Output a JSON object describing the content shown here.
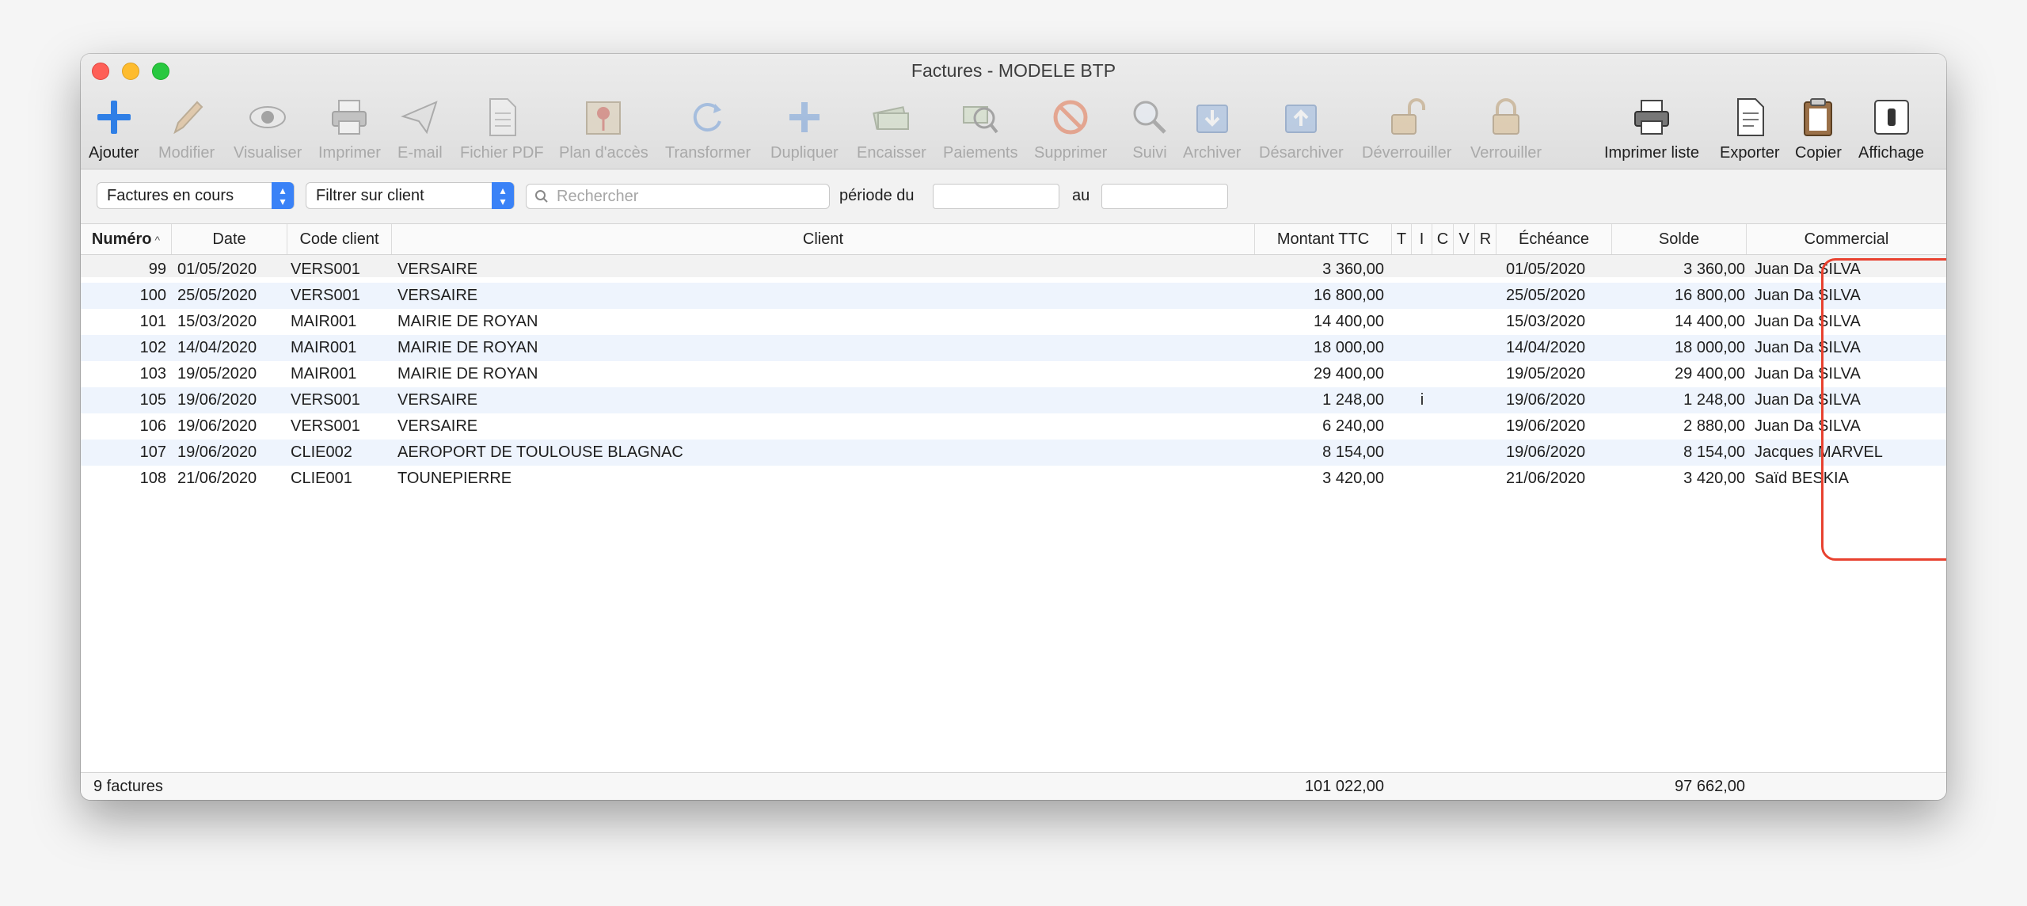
{
  "window": {
    "title": "Factures - MODELE BTP"
  },
  "toolbar": {
    "ajouter": "Ajouter",
    "modifier": "Modifier",
    "visualiser": "Visualiser",
    "imprimer": "Imprimer",
    "email": "E-mail",
    "pdf": "Fichier PDF",
    "plan": "Plan d'accès",
    "transformer": "Transformer",
    "dupliquer": "Dupliquer",
    "encaisser": "Encaisser",
    "paiements": "Paiements",
    "supprimer": "Supprimer",
    "suivi": "Suivi",
    "archiver": "Archiver",
    "desarchiver": "Désarchiver",
    "deverrouiller": "Déverrouiller",
    "verrouiller": "Verrouiller",
    "imprimer_liste": "Imprimer liste",
    "exporter": "Exporter",
    "copier": "Copier",
    "affichage": "Affichage"
  },
  "filters": {
    "status_select": "Factures en cours",
    "client_select": "Filtrer sur client",
    "search_placeholder": "Rechercher",
    "period_label": "période du",
    "to_label": "au"
  },
  "table": {
    "columns": [
      "Numéro",
      "Date",
      "Code client",
      "Client",
      "Montant TTC",
      "T",
      "I",
      "C",
      "V",
      "R",
      "Échéance",
      "Solde",
      "Commercial"
    ],
    "rows": [
      {
        "num": "99",
        "date": "01/05/2020",
        "code": "VERS001",
        "client": "VERSAIRE",
        "montant": "3 360,00",
        "i": "",
        "echeance": "01/05/2020",
        "solde": "3 360,00",
        "commercial": "Juan Da SILVA"
      },
      {
        "num": "100",
        "date": "25/05/2020",
        "code": "VERS001",
        "client": "VERSAIRE",
        "montant": "16 800,00",
        "i": "",
        "echeance": "25/05/2020",
        "solde": "16 800,00",
        "commercial": "Juan Da SILVA"
      },
      {
        "num": "101",
        "date": "15/03/2020",
        "code": "MAIR001",
        "client": "MAIRIE DE ROYAN",
        "montant": "14 400,00",
        "i": "",
        "echeance": "15/03/2020",
        "solde": "14 400,00",
        "commercial": "Juan Da SILVA"
      },
      {
        "num": "102",
        "date": "14/04/2020",
        "code": "MAIR001",
        "client": "MAIRIE DE ROYAN",
        "montant": "18 000,00",
        "i": "",
        "echeance": "14/04/2020",
        "solde": "18 000,00",
        "commercial": "Juan Da SILVA"
      },
      {
        "num": "103",
        "date": "19/05/2020",
        "code": "MAIR001",
        "client": "MAIRIE DE ROYAN",
        "montant": "29 400,00",
        "i": "",
        "echeance": "19/05/2020",
        "solde": "29 400,00",
        "commercial": "Juan Da SILVA"
      },
      {
        "num": "105",
        "date": "19/06/2020",
        "code": "VERS001",
        "client": "VERSAIRE",
        "montant": "1 248,00",
        "i": "i",
        "echeance": "19/06/2020",
        "solde": "1 248,00",
        "commercial": "Juan Da SILVA"
      },
      {
        "num": "106",
        "date": "19/06/2020",
        "code": "VERS001",
        "client": "VERSAIRE",
        "montant": "6 240,00",
        "i": "",
        "echeance": "19/06/2020",
        "solde": "2 880,00",
        "commercial": "Juan Da SILVA"
      },
      {
        "num": "107",
        "date": "19/06/2020",
        "code": "CLIE002",
        "client": "AEROPORT DE TOULOUSE BLAGNAC",
        "montant": "8 154,00",
        "i": "",
        "echeance": "19/06/2020",
        "solde": "8 154,00",
        "commercial": "Jacques MARVEL"
      },
      {
        "num": "108",
        "date": "21/06/2020",
        "code": "CLIE001",
        "client": "TOUNEPIERRE",
        "montant": "3 420,00",
        "i": "",
        "echeance": "21/06/2020",
        "solde": "3 420,00",
        "commercial": "Saïd BESKIA"
      }
    ]
  },
  "footer": {
    "count": "9 factures",
    "total_montant": "101 022,00",
    "total_solde": "97 662,00"
  },
  "colors": {
    "accent": "#3a82f7",
    "row_alt": "#eef4fd",
    "highlight": "#e8412f"
  }
}
